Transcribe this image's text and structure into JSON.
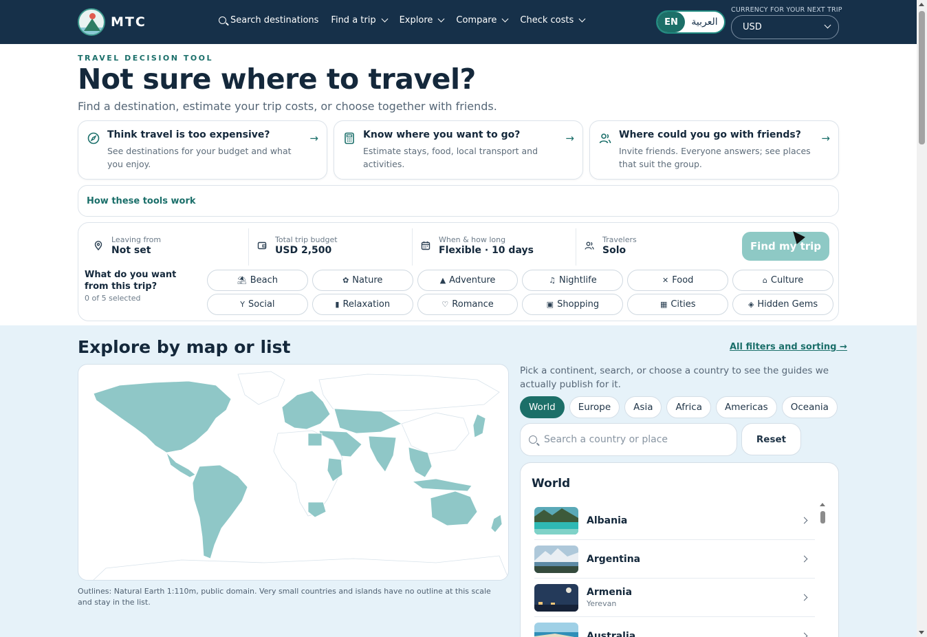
{
  "header": {
    "logo_text": "MTC",
    "nav": [
      {
        "label": "Search destinations"
      },
      {
        "label": "Find a trip"
      },
      {
        "label": "Explore"
      },
      {
        "label": "Compare"
      },
      {
        "label": "Check costs"
      }
    ],
    "lang_en": "EN",
    "lang_ar": "العربية",
    "currency_label": "CURRENCY FOR YOUR NEXT TRIP",
    "currency_value": "USD"
  },
  "hero": {
    "eyebrow": "TRAVEL DECISION TOOL",
    "title": "Not sure where to travel?",
    "subtitle": "Find a destination, estimate your trip costs, or choose together with friends."
  },
  "cards": [
    {
      "title": "Think travel is too expensive?",
      "desc": "See destinations for your budget and what you enjoy."
    },
    {
      "title": "Know where you want to go?",
      "desc": "Estimate stays, food, local transport and activities."
    },
    {
      "title": "Where could you go with friends?",
      "desc": "Invite friends. Everyone answers; see places that suit the group."
    }
  ],
  "howto": "How these tools work",
  "planner": {
    "fields": [
      {
        "label": "Leaving from",
        "value": "Not set"
      },
      {
        "label": "Total trip budget",
        "value": "USD 2,500"
      },
      {
        "label": "When & how long",
        "value": "Flexible · 10 days"
      },
      {
        "label": "Travelers",
        "value": "Solo"
      }
    ],
    "find_label": "Find my trip",
    "want_label": "What do you want from this trip?",
    "want_count": "0 of 5 selected",
    "interests": [
      {
        "label": "Beach",
        "icon": "⛱"
      },
      {
        "label": "Nature",
        "icon": "✿"
      },
      {
        "label": "Adventure",
        "icon": "▲"
      },
      {
        "label": "Nightlife",
        "icon": "♫"
      },
      {
        "label": "Food",
        "icon": "✕"
      },
      {
        "label": "Culture",
        "icon": "⌂"
      },
      {
        "label": "Social",
        "icon": "Y"
      },
      {
        "label": "Relaxation",
        "icon": "▮"
      },
      {
        "label": "Romance",
        "icon": "♡"
      },
      {
        "label": "Shopping",
        "icon": "▣"
      },
      {
        "label": "Cities",
        "icon": "▦"
      },
      {
        "label": "Hidden Gems",
        "icon": "◈"
      }
    ]
  },
  "explore": {
    "title": "Explore by map or list",
    "filters_link": "All filters and sorting",
    "map_note": "Outlines: Natural Earth 1:110m, public domain. Very small countries and islands have no outline at this scale and stay in the list.",
    "pick_text": "Pick a continent, search, or choose a country to see the guides we actually publish for it.",
    "regions": [
      "World",
      "Europe",
      "Asia",
      "Africa",
      "Americas",
      "Oceania"
    ],
    "active_region": "World",
    "search_placeholder": "Search a country or place",
    "reset_label": "Reset",
    "list_title": "World",
    "countries": [
      {
        "name": "Albania",
        "sub": ""
      },
      {
        "name": "Argentina",
        "sub": ""
      },
      {
        "name": "Armenia",
        "sub": "Yerevan"
      },
      {
        "name": "Australia",
        "sub": ""
      }
    ]
  },
  "colors": {
    "navy": "#163049",
    "teal": "#1c6f68",
    "map_land_available": "#8fc7c7",
    "explore_bg": "#e6f2f9"
  }
}
